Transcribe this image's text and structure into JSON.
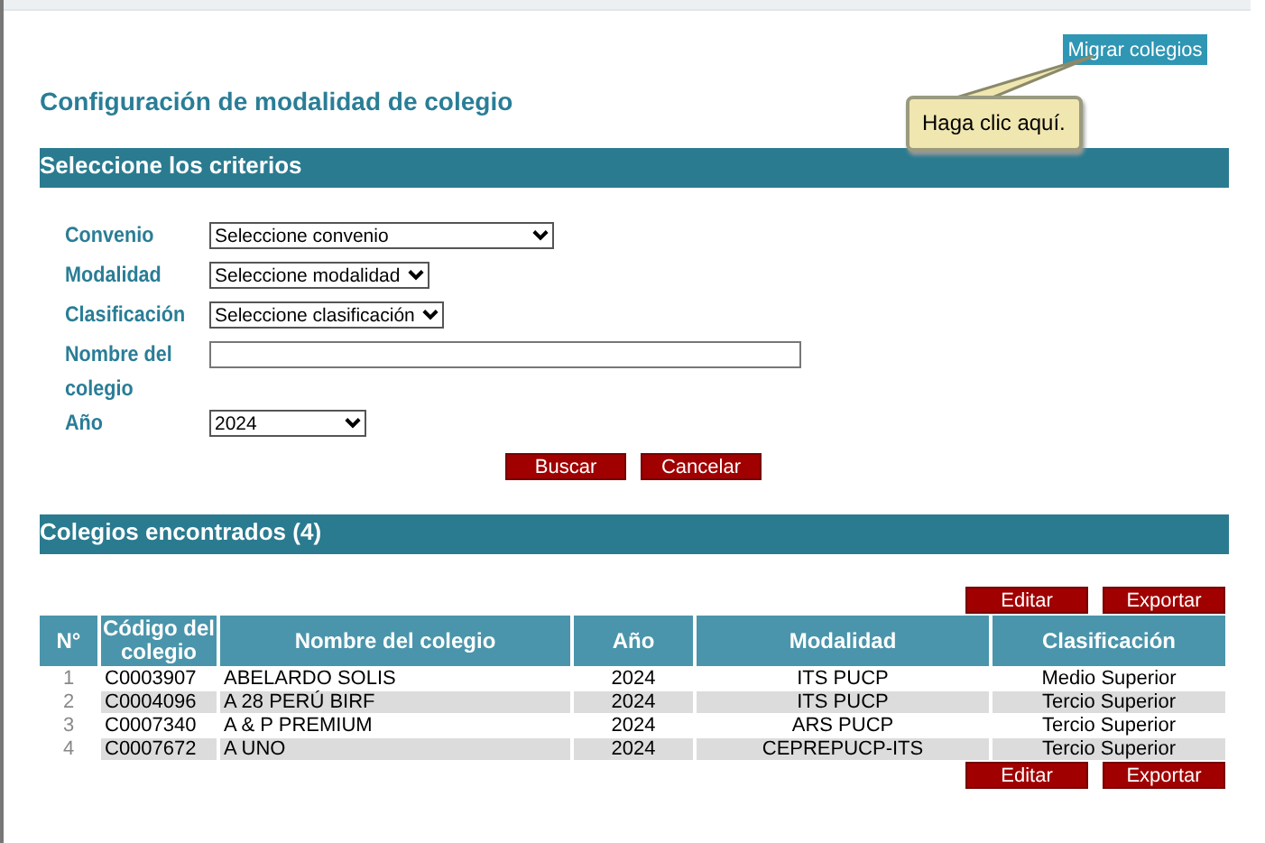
{
  "migrate_button": "Migrar colegios",
  "tooltip": "Haga clic aquí.",
  "title": "Configuración de modalidad de colegio",
  "criteria_header": "Seleccione los criterios",
  "fields": [
    {
      "kind": "wide_select",
      "label": "Convenio",
      "value": "Seleccione convenio"
    },
    {
      "kind": "select",
      "label": "Modalidad",
      "value": "Seleccione modalidad"
    },
    {
      "kind": "select",
      "label": "Clasificación",
      "value": "Seleccione clasificación"
    },
    {
      "kind": "text",
      "label": "Nombre del colegio"
    },
    {
      "kind": "short_select",
      "label": "Año",
      "value": "2024"
    }
  ],
  "form_buttons": [
    "Buscar",
    "Cancelar"
  ],
  "results_header": "Colegios encontrados (4)",
  "table_buttons_top": [
    "Editar",
    "Exportar"
  ],
  "table": {
    "columns": [
      "N°",
      "Código del colegio",
      "Nombre del colegio",
      "Año",
      "Modalidad",
      "Clasificación"
    ],
    "rows": [
      [
        "1",
        "C0003907",
        "ABELARDO SOLIS",
        "2024",
        "ITS PUCP",
        "Medio Superior"
      ],
      [
        "2",
        "C0004096",
        "A 28 PERÚ BIRF",
        "2024",
        "ITS PUCP",
        "Tercio Superior"
      ],
      [
        "3",
        "C0007340",
        "A & P PREMIUM",
        "2024",
        "ARS PUCP",
        "Tercio Superior"
      ],
      [
        "4",
        "C0007672",
        "A UNO",
        "2024",
        "CEPREPUCP-ITS",
        "Tercio Superior"
      ]
    ]
  },
  "table_buttons_bottom": [
    "Editar",
    "Exportar"
  ]
}
